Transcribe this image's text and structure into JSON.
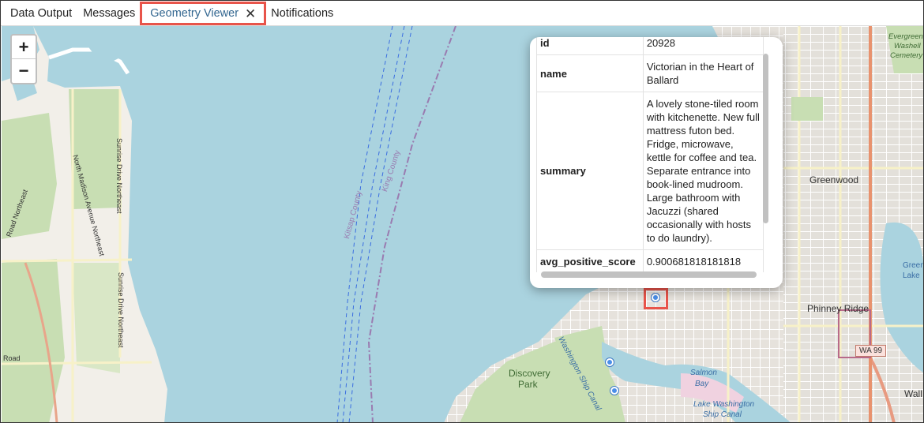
{
  "tabs": [
    {
      "label": "Data Output"
    },
    {
      "label": "Messages"
    },
    {
      "label": "Geometry Viewer",
      "close": "✕"
    },
    {
      "label": "Notifications"
    }
  ],
  "zoom": {
    "in": "+",
    "out": "−"
  },
  "popup": {
    "rows": [
      {
        "key": "id",
        "value": "20928"
      },
      {
        "key": "name",
        "value": "Victorian in the Heart of Ballard"
      },
      {
        "key": "summary",
        "value": "A lovely stone-tiled room with kitchenette. New full mattress futon bed. Fridge, microwave, kettle for coffee and tea. Separate entrance into book-lined mudroom. Large bathroom with Jacuzzi (shared occasionally with hosts to do laundry)."
      },
      {
        "key": "avg_positive_score",
        "value": "0.900681818181818"
      }
    ]
  },
  "map_labels": {
    "greenwood": "Greenwood",
    "phinney_ridge": "Phinney Ridge",
    "discovery_park_1": "Discovery",
    "discovery_park_2": "Park",
    "salmon_bay_1": "Salmon",
    "salmon_bay_2": "Bay",
    "lake_washington_ship_canal_1": "Lake Washington",
    "lake_washington_ship_canal_2": "Ship Canal",
    "ship_canal_vertical": "Washington Ship Canal",
    "kitsap_county": "Kitsap County",
    "king_county": "King County",
    "sunrise_drive_1": "Sunrise Drive Northeast",
    "sunrise_drive_2": "Sunrise Drive Northeast",
    "north_madison": "North Madison Avenue Northeast",
    "road_northeast": "Road Northeast",
    "road": "Road",
    "wa99": "WA 99",
    "green_lake_1": "Green",
    "green_lake_2": "Lake",
    "evergreen_1": "Evergreen",
    "evergreen_2": "Washell",
    "evergreen_3": "Cemetery",
    "wall": "Wall"
  },
  "colors": {
    "water": "#aad3df",
    "land": "#f2efe9",
    "park": "#c8deb3",
    "highlight": "#e8544a",
    "accent": "#326690"
  }
}
